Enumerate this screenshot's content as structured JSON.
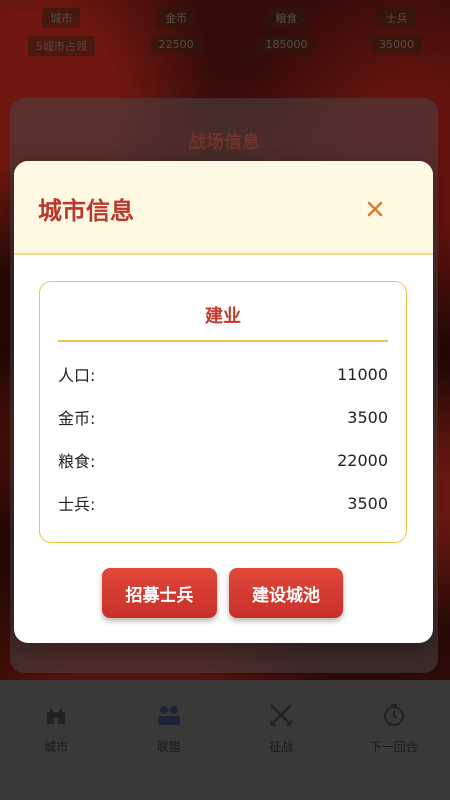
{
  "top_stats": [
    {
      "label": "城市",
      "value": "5城市占领"
    },
    {
      "label": "金币",
      "value": "22500"
    },
    {
      "label": "粮食",
      "value": "185000"
    },
    {
      "label": "士兵",
      "value": "35000"
    }
  ],
  "background_panel": {
    "title": "战场信息"
  },
  "bottom_nav": [
    {
      "label": "城市",
      "icon": "castle-icon"
    },
    {
      "label": "联盟",
      "icon": "people-icon"
    },
    {
      "label": "征战",
      "icon": "crossed-swords-icon"
    },
    {
      "label": "下一回合",
      "icon": "clock-icon"
    }
  ],
  "modal": {
    "title": "城市信息",
    "close_symbol": "✕",
    "city_name": "建业",
    "stats": [
      {
        "label": "人口:",
        "value": "11000"
      },
      {
        "label": "金币:",
        "value": "3500"
      },
      {
        "label": "粮食:",
        "value": "22000"
      },
      {
        "label": "士兵:",
        "value": "3500"
      }
    ],
    "buttons": {
      "recruit": "招募士兵",
      "build": "建设城池"
    }
  },
  "colors": {
    "accent": "#c0392b",
    "header_bg": "#fff8e3",
    "card_border": "#f0c24a",
    "close": "#e07a2a"
  }
}
